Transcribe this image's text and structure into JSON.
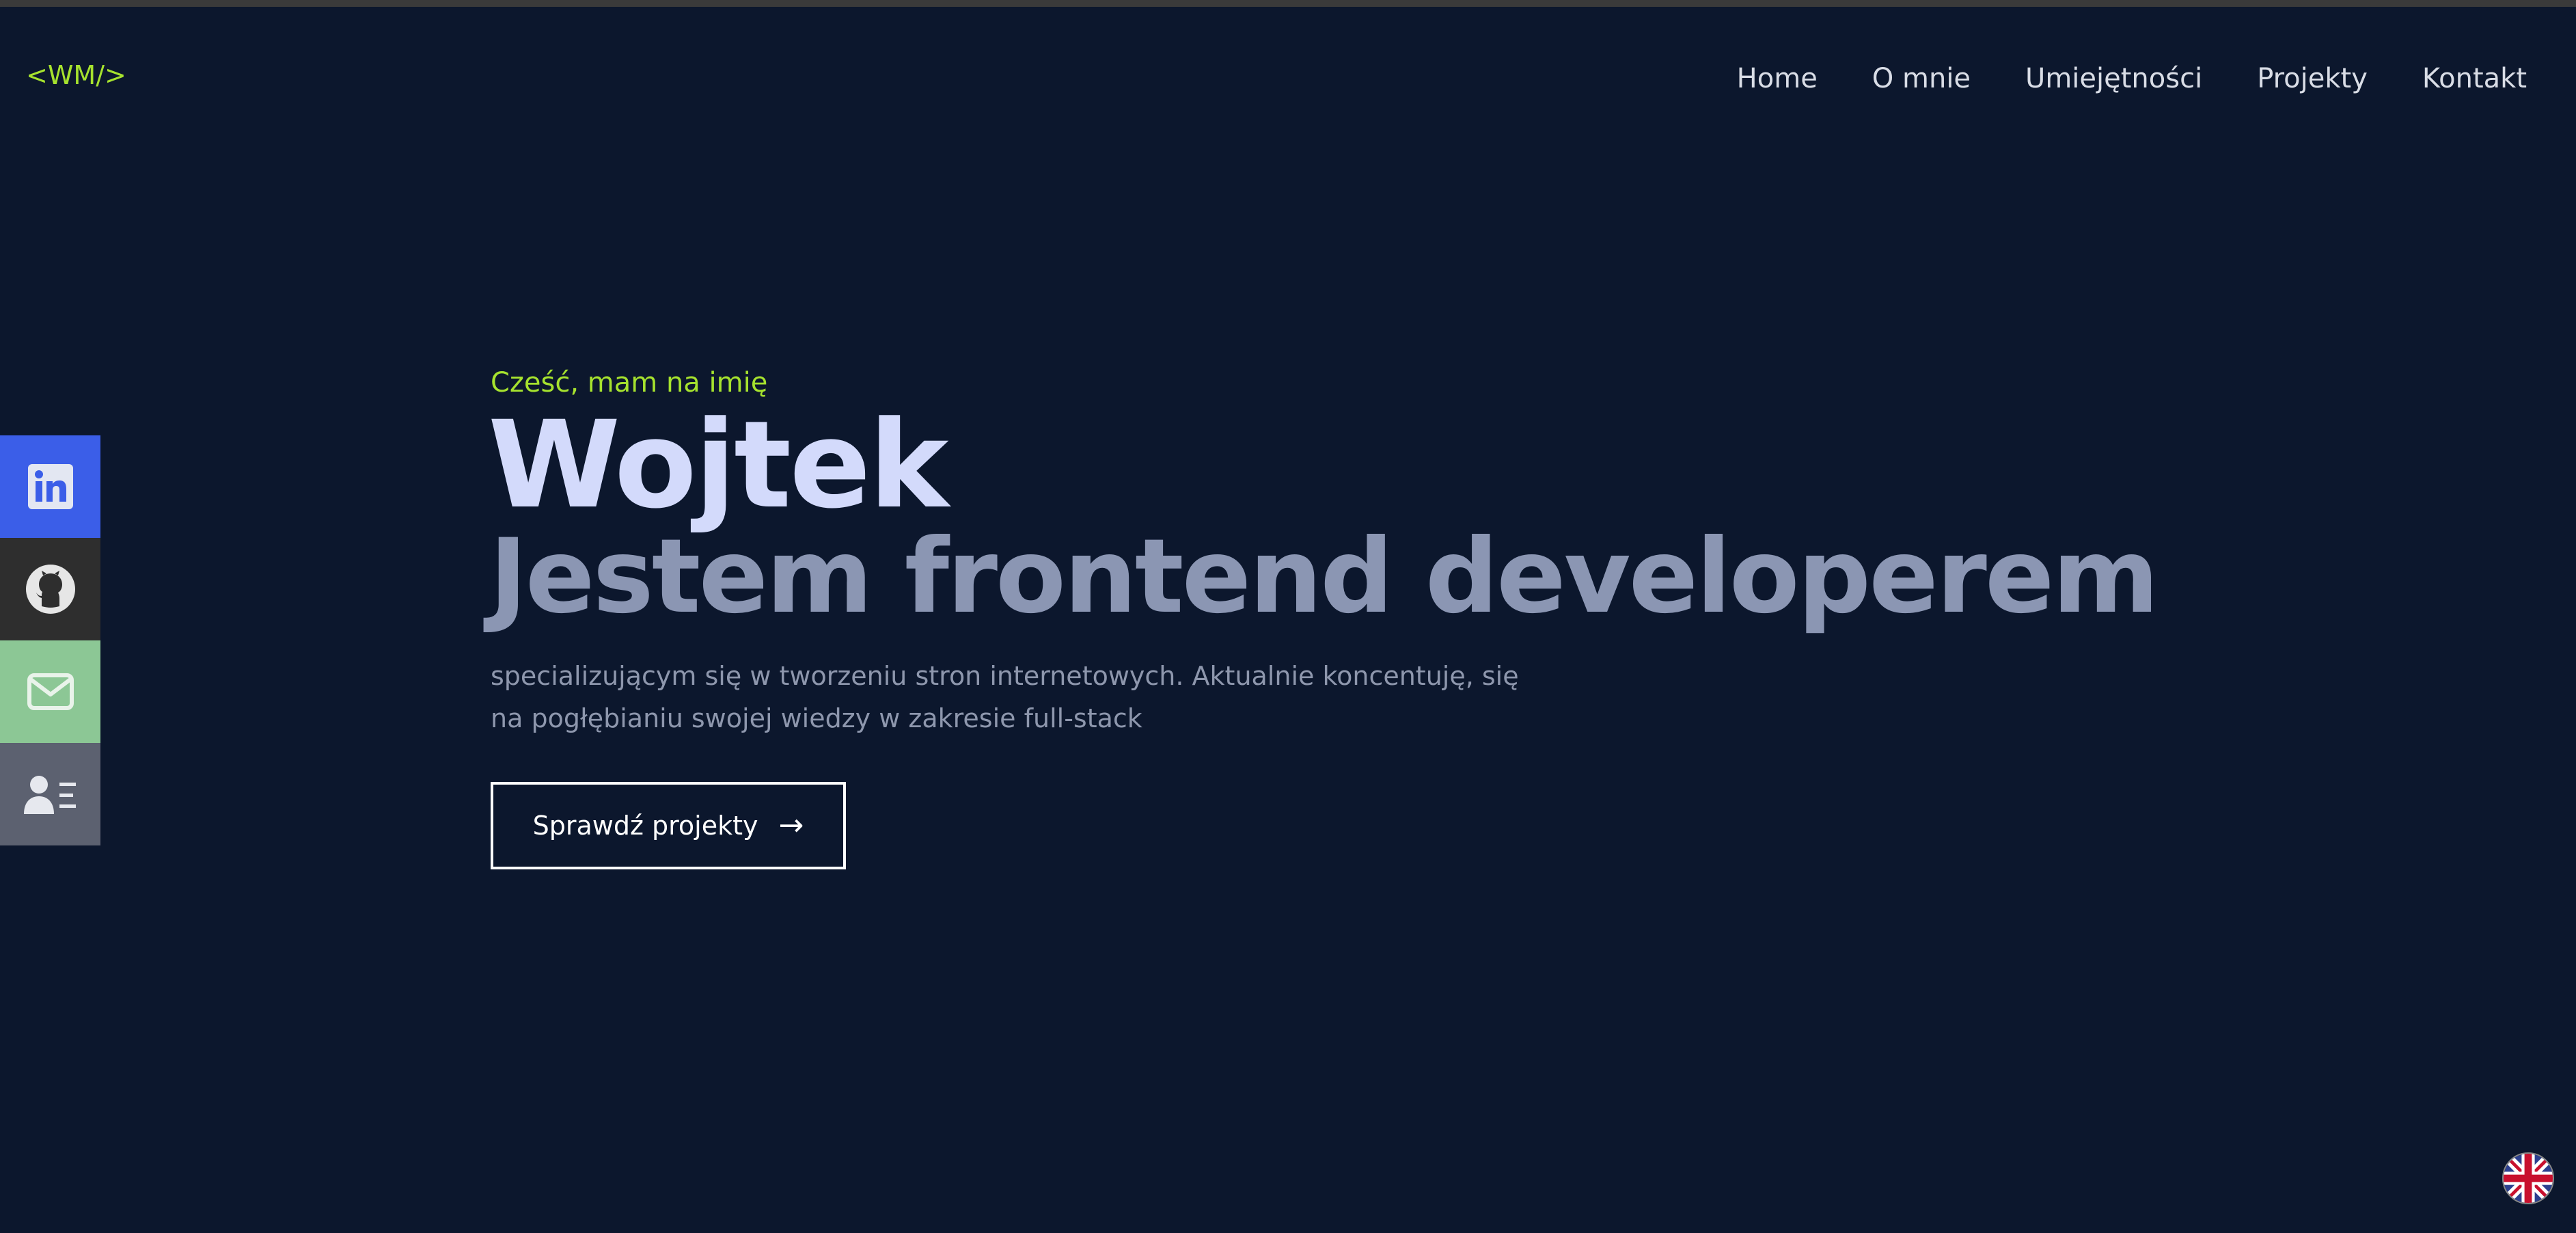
{
  "logo": "<WM/>",
  "nav": {
    "items": [
      "Home",
      "O mnie",
      "Umiejętności",
      "Projekty",
      "Kontakt"
    ]
  },
  "socials": [
    {
      "icon": "linkedin-icon",
      "color": "#3b5ee8"
    },
    {
      "icon": "github-icon",
      "color": "#2e2e2e"
    },
    {
      "icon": "mail-icon",
      "color": "#8cc795"
    },
    {
      "icon": "contact-card-icon",
      "color": "#5c6170"
    }
  ],
  "hero": {
    "greeting": "Cześć, mam na imię",
    "name": "Wojtek",
    "role": "Jestem frontend developerem",
    "description": "specializującym się w tworzeniu stron internetowych. Aktualnie koncentuję, się na pogłębianiu swojej wiedzy w zakresie full-stack",
    "cta_label": "Sprawdź projekty",
    "cta_icon": "arrow-right-icon"
  },
  "language_switch": {
    "icon": "uk-flag-icon"
  },
  "colors": {
    "background": "#0c172d",
    "accent": "#a6e22e",
    "name": "#d3dafb",
    "role": "#8b96b3"
  }
}
